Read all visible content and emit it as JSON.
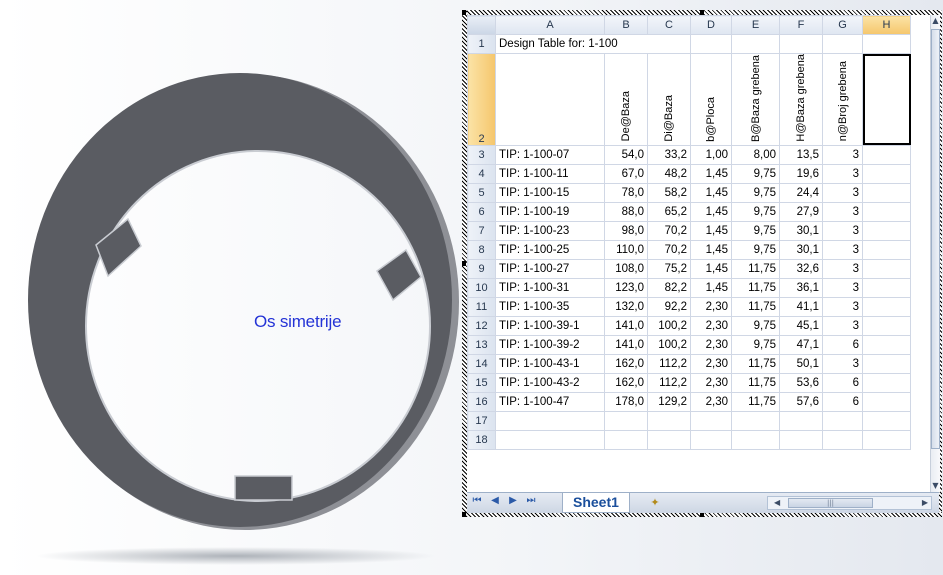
{
  "viewport": {
    "annotation_label": "Os simetrije"
  },
  "spreadsheet": {
    "columns": [
      "A",
      "B",
      "C",
      "D",
      "E",
      "F",
      "G",
      "H"
    ],
    "row1_title": "Design Table for: 1-100",
    "param_headers": [
      "De@Baza",
      "Di@Baza",
      "b@Ploca",
      "B@Baza grebena",
      "H@Baza grebena",
      "n@Broj grebena"
    ],
    "rows": [
      {
        "row": "3",
        "name": "TIP: 1-100-07",
        "De": "54,0",
        "Di": "33,2",
        "b": "1,00",
        "B": "8,00",
        "H": "13,5",
        "n": "3"
      },
      {
        "row": "4",
        "name": "TIP: 1-100-11",
        "De": "67,0",
        "Di": "48,2",
        "b": "1,45",
        "B": "9,75",
        "H": "19,6",
        "n": "3"
      },
      {
        "row": "5",
        "name": "TIP: 1-100-15",
        "De": "78,0",
        "Di": "58,2",
        "b": "1,45",
        "B": "9,75",
        "H": "24,4",
        "n": "3"
      },
      {
        "row": "6",
        "name": "TIP: 1-100-19",
        "De": "88,0",
        "Di": "65,2",
        "b": "1,45",
        "B": "9,75",
        "H": "27,9",
        "n": "3"
      },
      {
        "row": "7",
        "name": "TIP: 1-100-23",
        "De": "98,0",
        "Di": "70,2",
        "b": "1,45",
        "B": "9,75",
        "H": "30,1",
        "n": "3"
      },
      {
        "row": "8",
        "name": "TIP: 1-100-25",
        "De": "110,0",
        "Di": "70,2",
        "b": "1,45",
        "B": "9,75",
        "H": "30,1",
        "n": "3"
      },
      {
        "row": "9",
        "name": "TIP: 1-100-27",
        "De": "108,0",
        "Di": "75,2",
        "b": "1,45",
        "B": "11,75",
        "H": "32,6",
        "n": "3"
      },
      {
        "row": "10",
        "name": "TIP: 1-100-31",
        "De": "123,0",
        "Di": "82,2",
        "b": "1,45",
        "B": "11,75",
        "H": "36,1",
        "n": "3"
      },
      {
        "row": "11",
        "name": "TIP: 1-100-35",
        "De": "132,0",
        "Di": "92,2",
        "b": "2,30",
        "B": "11,75",
        "H": "41,1",
        "n": "3"
      },
      {
        "row": "12",
        "name": "TIP: 1-100-39-1",
        "De": "141,0",
        "Di": "100,2",
        "b": "2,30",
        "B": "9,75",
        "H": "45,1",
        "n": "3"
      },
      {
        "row": "13",
        "name": "TIP: 1-100-39-2",
        "De": "141,0",
        "Di": "100,2",
        "b": "2,30",
        "B": "9,75",
        "H": "47,1",
        "n": "6"
      },
      {
        "row": "14",
        "name": "TIP: 1-100-43-1",
        "De": "162,0",
        "Di": "112,2",
        "b": "2,30",
        "B": "11,75",
        "H": "50,1",
        "n": "3"
      },
      {
        "row": "15",
        "name": "TIP: 1-100-43-2",
        "De": "162,0",
        "Di": "112,2",
        "b": "2,30",
        "B": "11,75",
        "H": "53,6",
        "n": "6"
      },
      {
        "row": "16",
        "name": "TIP: 1-100-47",
        "De": "178,0",
        "Di": "129,2",
        "b": "2,30",
        "B": "11,75",
        "H": "57,6",
        "n": "6"
      }
    ],
    "empty_rows": [
      "17",
      "18"
    ],
    "sheet_tab": "Sheet1",
    "colors": {
      "selected_header": "#f5c66c",
      "grid_line": "#d0d7e5",
      "header_border": "#9eb6ce"
    }
  }
}
